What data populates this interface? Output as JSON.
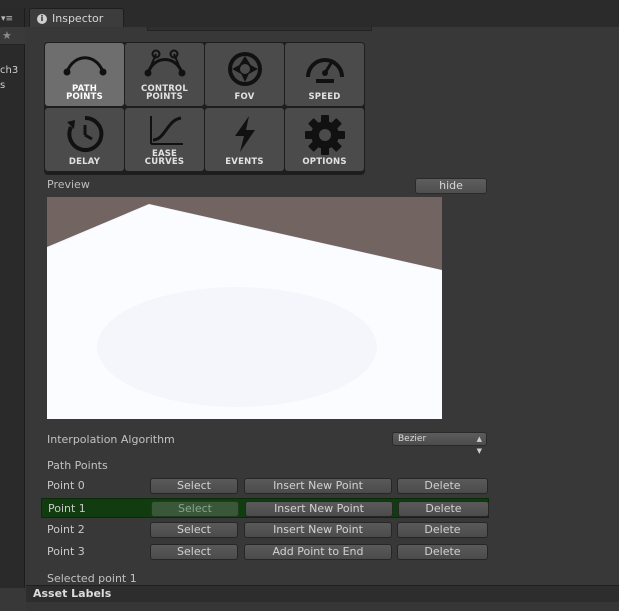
{
  "window": {
    "tab_label": "Inspector",
    "left_panel_items": [
      "ch3",
      "s"
    ]
  },
  "toolbar": {
    "buttons": [
      {
        "label": "PATH\nPOINTS",
        "icon": "path-points-icon",
        "active": true
      },
      {
        "label": "CONTROL\nPOINTS",
        "icon": "control-points-icon",
        "active": false
      },
      {
        "label": "FOV",
        "icon": "fov-icon",
        "active": false
      },
      {
        "label": "SPEED",
        "icon": "speed-icon",
        "active": false
      },
      {
        "label": "DELAY",
        "icon": "delay-icon",
        "active": false
      },
      {
        "label": "EASE\nCURVES",
        "icon": "ease-curves-icon",
        "active": false
      },
      {
        "label": "EVENTS",
        "icon": "events-icon",
        "active": false
      },
      {
        "label": "OPTIONS",
        "icon": "options-icon",
        "active": false
      }
    ]
  },
  "preview": {
    "label": "Preview",
    "hide_label": "hide"
  },
  "interpolation": {
    "label": "Interpolation Algorithm",
    "value": "Bezier"
  },
  "path_points": {
    "label": "Path Points",
    "select_label": "Select",
    "delete_label": "Delete",
    "rows": [
      {
        "name": "Point 0",
        "action": "Insert New Point",
        "selected": false
      },
      {
        "name": "Point 1",
        "action": "Insert New Point",
        "selected": true
      },
      {
        "name": "Point 2",
        "action": "Insert New Point",
        "selected": false
      },
      {
        "name": "Point 3",
        "action": "Add Point to End",
        "selected": false
      }
    ]
  },
  "selected_point_label": "Selected point 1",
  "asset_labels": "Asset Labels",
  "colors": {
    "selected_row": "#113c0f",
    "sky": "#726460",
    "ground": "#f6f8fd"
  }
}
